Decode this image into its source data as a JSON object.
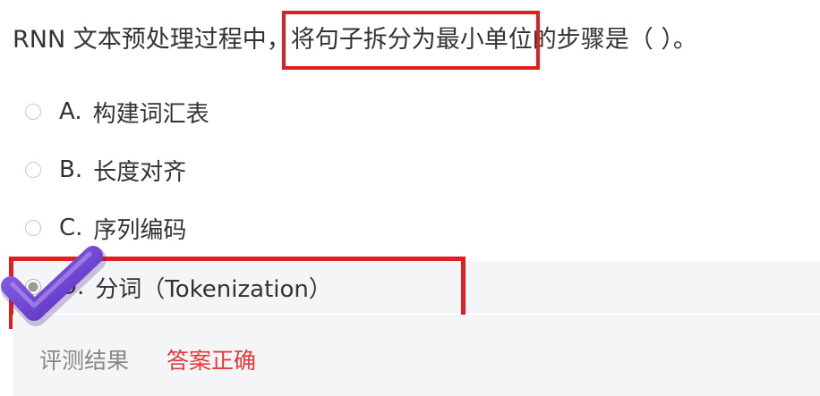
{
  "question": {
    "prefix": "RNN 文本预处理过程中，",
    "highlight": "将句子拆分为最小单位",
    "suffix": "的步骤是（ ）。"
  },
  "options": [
    {
      "letter": "A.",
      "text": "构建词汇表"
    },
    {
      "letter": "B.",
      "text": "长度对齐"
    },
    {
      "letter": "C.",
      "text": "序列编码"
    },
    {
      "letter": "D.",
      "text": "分词（Tokenization）"
    }
  ],
  "selected_option": "D",
  "result": {
    "label": "评测结果",
    "value": "答案正确"
  },
  "colors": {
    "highlight_border": "#e02020",
    "correct_text": "#e83838",
    "check_mark": "#6a3fd0"
  },
  "icons": {
    "check_mark": "check-mark-icon"
  }
}
